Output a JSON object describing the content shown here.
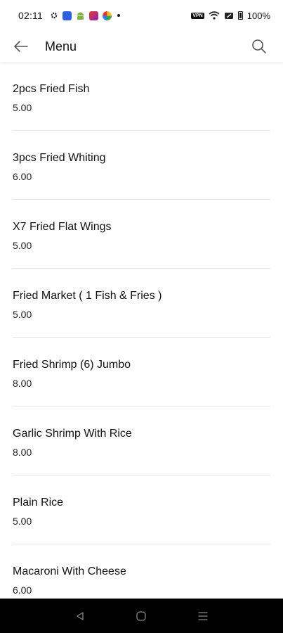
{
  "status_bar": {
    "time": "02:11",
    "battery": "100%",
    "vpn": "VPN"
  },
  "app_bar": {
    "title": "Menu",
    "back_icon": "arrow-left-icon",
    "search_icon": "search-icon"
  },
  "menu_items": [
    {
      "name": "2pcs Fried Fish",
      "price": "5.00"
    },
    {
      "name": "3pcs Fried Whiting",
      "price": "6.00"
    },
    {
      "name": "X7 Fried Flat Wings",
      "price": "5.00"
    },
    {
      "name": "Fried Market ( 1 Fish & Fries )",
      "price": "5.00"
    },
    {
      "name": "Fried Shrimp (6) Jumbo",
      "price": "8.00"
    },
    {
      "name": "Garlic Shrimp With Rice",
      "price": "8.00"
    },
    {
      "name": "Plain Rice",
      "price": "5.00"
    },
    {
      "name": "Macaroni With Cheese",
      "price": "6.00"
    }
  ],
  "nav_bar": {
    "back_icon": "nav-back-icon",
    "home_icon": "nav-home-icon",
    "recents_icon": "nav-recents-icon"
  }
}
